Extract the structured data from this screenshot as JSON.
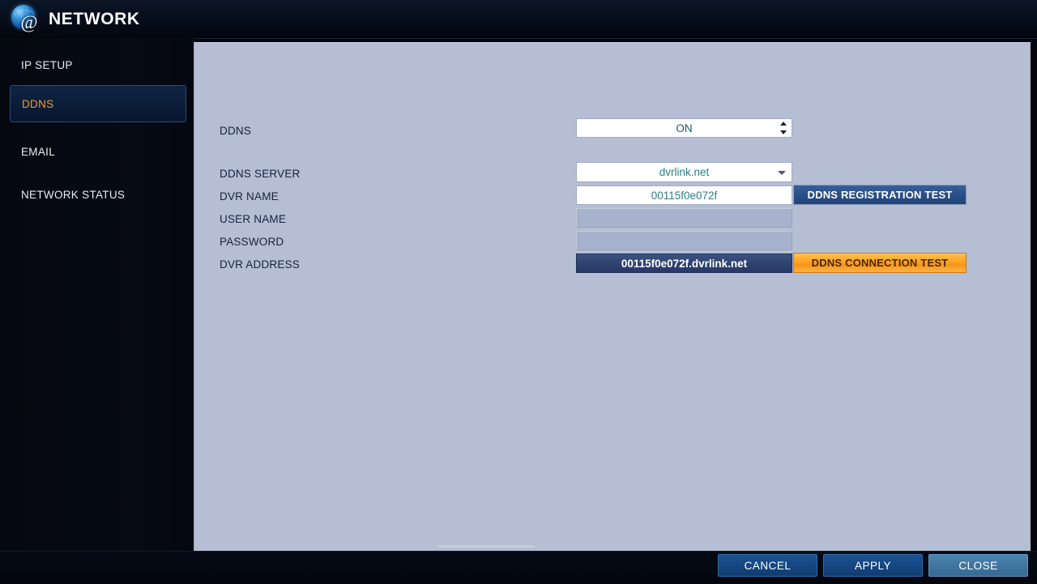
{
  "header": {
    "title": "NETWORK",
    "icon": "globe-at-icon"
  },
  "sidebar": {
    "items": [
      {
        "label": "IP SETUP",
        "selected": false
      },
      {
        "label": "DDNS",
        "selected": true
      },
      {
        "label": "EMAIL",
        "selected": false
      },
      {
        "label": "NETWORK STATUS",
        "selected": false
      }
    ]
  },
  "form": {
    "rows": [
      {
        "label": "DDNS",
        "value": "ON",
        "control": "spinner"
      },
      {
        "label": "DDNS SERVER",
        "value": "dvrlink.net",
        "control": "dropdown"
      },
      {
        "label": "DVR NAME",
        "value": "00115f0e072f",
        "control": "text"
      },
      {
        "label": "USER NAME",
        "value": "",
        "control": "text"
      },
      {
        "label": "PASSWORD",
        "value": "",
        "control": "password"
      },
      {
        "label": "DVR ADDRESS",
        "value": "00115f0e072f.dvrlink.net",
        "control": "readonly"
      }
    ],
    "registration_test_label": "DDNS REGISTRATION TEST",
    "connection_test_label": "DDNS CONNECTION TEST"
  },
  "footer": {
    "cancel_label": "CANCEL",
    "apply_label": "APPLY",
    "close_label": "CLOSE"
  },
  "colors": {
    "panel_bg": "#b5bed2",
    "accent_orange": "#f7941d",
    "selected_text": "#e89c3c",
    "field_text": "#2e7f82",
    "label_text": "#16233d",
    "button_blue": "#154680"
  }
}
